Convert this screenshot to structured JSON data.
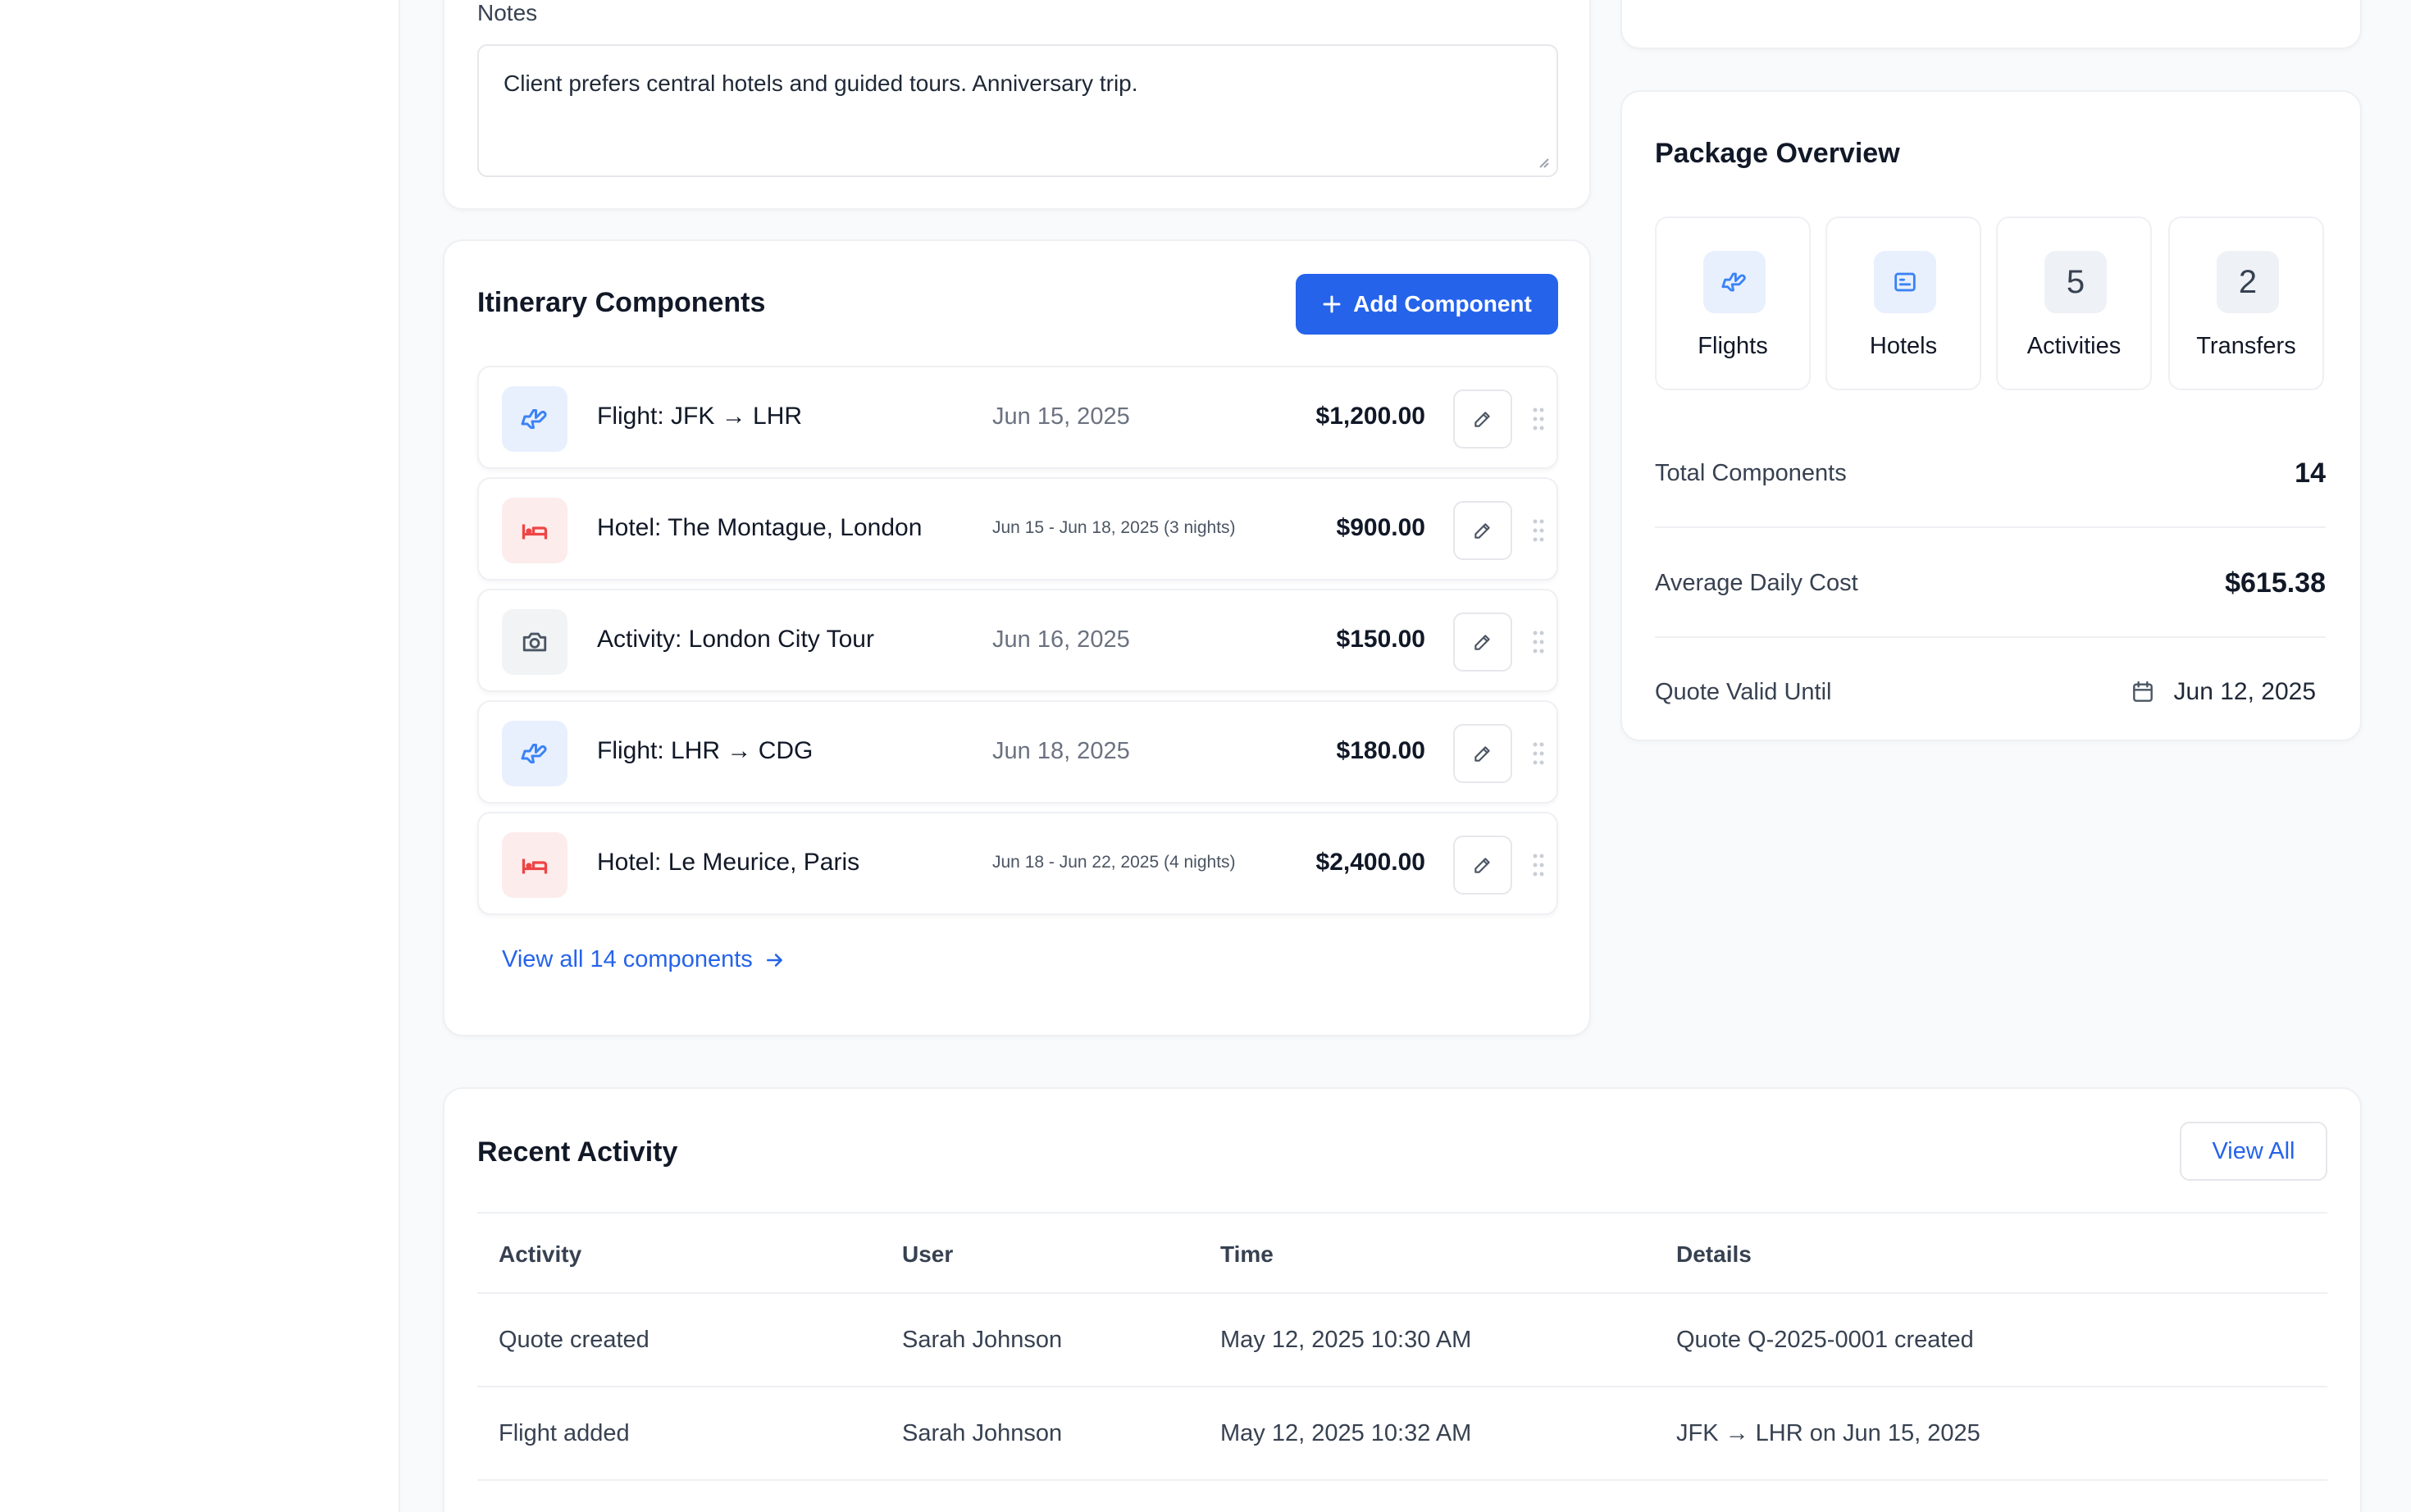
{
  "notes": {
    "label": "Notes",
    "value": "Client prefers central hotels and guided tours. Anniversary trip."
  },
  "itinerary": {
    "title": "Itinerary Components",
    "add_button_label": "Add Component",
    "components": [
      {
        "icon": "plane-icon",
        "name": "Flight: JFK → LHR",
        "date": "Jun 15, 2025",
        "price": "$1,200.00"
      },
      {
        "icon": "bed-icon",
        "name": "Hotel: The Montague, London",
        "date": "Jun 15 - Jun 18, 2025 (3 nights)",
        "price": "$900.00"
      },
      {
        "icon": "camera-icon",
        "name": "Activity: London City Tour",
        "date": "Jun 16, 2025",
        "price": "$150.00"
      },
      {
        "icon": "plane-icon",
        "name": "Flight: LHR → CDG",
        "date": "Jun 18, 2025",
        "price": "$180.00"
      },
      {
        "icon": "bed-icon",
        "name": "Hotel: Le Meurice, Paris",
        "date": "Jun 18 - Jun 22, 2025 (4 nights)",
        "price": "$2,400.00"
      }
    ],
    "view_all_label": "View all 14 components"
  },
  "overview": {
    "title": "Package Overview",
    "tiles": [
      {
        "badge": "",
        "icon": "plane-icon",
        "label": "Flights"
      },
      {
        "badge": "",
        "icon": "hotel-icon",
        "label": "Hotels"
      },
      {
        "badge": "5",
        "label": "Activities"
      },
      {
        "badge": "2",
        "label": "Transfers"
      }
    ],
    "total_components_label": "Total Components",
    "total_components_value": "14",
    "avg_daily_cost_label": "Average Daily Cost",
    "avg_daily_cost_value": "$615.38",
    "quote_valid_label": "Quote Valid Until",
    "quote_valid_value": "Jun 12, 2025"
  },
  "activity": {
    "title": "Recent Activity",
    "view_all_label": "View All",
    "columns": [
      "Activity",
      "User",
      "Time",
      "Details"
    ],
    "rows": [
      {
        "activity": "Quote created",
        "user": "Sarah Johnson",
        "time": "May 12, 2025 10:30 AM",
        "details": "Quote Q-2025-0001 created"
      },
      {
        "activity": "Flight added",
        "user": "Sarah Johnson",
        "time": "May 12, 2025 10:32 AM",
        "details": "JFK → LHR on Jun 15, 2025"
      }
    ]
  },
  "colors": {
    "accent": "#2563eb",
    "flight_icon": "#3b82f6",
    "hotel_icon": "#ef4444",
    "background": "#f9fafb"
  }
}
